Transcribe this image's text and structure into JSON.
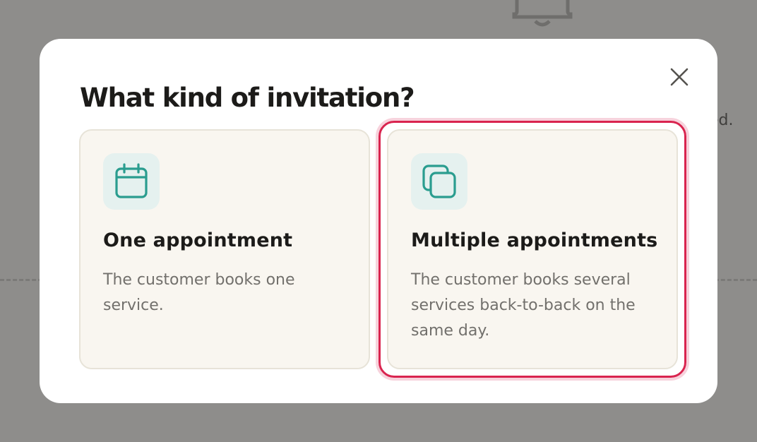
{
  "background": {
    "partial_text": "ed.",
    "icon": "bell-icon"
  },
  "modal": {
    "title": "What kind of invitation?",
    "close_icon": "close-icon",
    "options": [
      {
        "icon": "calendar-icon",
        "title": "One appointment",
        "description": "The customer books one service."
      },
      {
        "icon": "stacked-squares-icon",
        "title": "Multiple appointments",
        "description": "The customer books several services back-to-back on the same day.",
        "focused": true
      }
    ]
  },
  "colors": {
    "accent": "#2a9d8f",
    "icon_tile": "#e5f1ef",
    "card_bg": "#f9f6f0",
    "focus_ring": "#d9244f",
    "backdrop": "#8e8d8b"
  }
}
